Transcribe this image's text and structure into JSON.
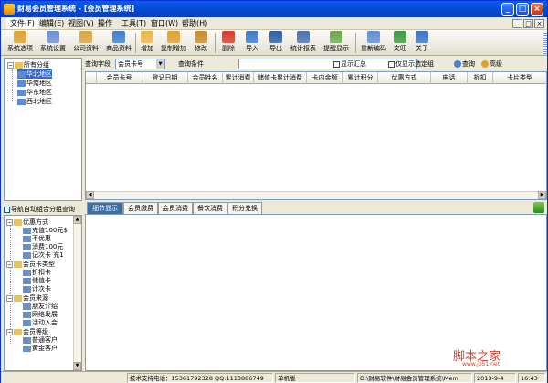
{
  "window": {
    "title": "财易会员管理系统 - [会员管理系统]"
  },
  "menu": [
    "文件(F)",
    "编辑(E)",
    "视图(V)",
    "操作",
    "工具(T)",
    "窗口(W)",
    "帮助(H)"
  ],
  "mdi_controls": [
    "_",
    "□",
    "×"
  ],
  "window_controls": [
    "_",
    "□",
    "×"
  ],
  "toolbar": [
    {
      "label": "系统选项",
      "icon": "settings-folder-icon",
      "color": "#e0a030"
    },
    {
      "label": "系统设置",
      "icon": "tools-icon",
      "color": "#6b8fd6"
    },
    {
      "label": "公司资料",
      "icon": "company-icon",
      "color": "#d9a441"
    },
    {
      "label": "商品资料",
      "icon": "goods-icon",
      "color": "#3f7fd0"
    },
    {
      "label": "增加",
      "icon": "add-icon",
      "color": "#e8b84a"
    },
    {
      "label": "复制增加",
      "icon": "copy-add-icon",
      "color": "#e0a030"
    },
    {
      "label": "修改",
      "icon": "edit-icon",
      "color": "#c98b2c"
    },
    {
      "label": "删除",
      "icon": "delete-icon",
      "color": "#d83a2a"
    },
    {
      "label": "导入",
      "icon": "import-icon",
      "color": "#3c78c9"
    },
    {
      "label": "导出",
      "icon": "export-icon",
      "color": "#2d5fa8"
    },
    {
      "label": "统计报表",
      "icon": "report-icon",
      "color": "#4a6fb5"
    },
    {
      "label": "提醒显示",
      "icon": "reminder-icon",
      "color": "#6aa84f"
    },
    {
      "label": "重新编码",
      "icon": "recode-icon",
      "color": "#5f8fd6"
    },
    {
      "label": "文旺",
      "icon": "person-icon",
      "color": "#3d9a3d"
    },
    {
      "label": "关于",
      "icon": "help-icon",
      "color": "#3a73c9"
    }
  ],
  "group_tree": {
    "root": "所有分组",
    "items": [
      "华北地区",
      "华南地区",
      "华东地区",
      "西北地区"
    ]
  },
  "auto_query_label": "导航自动组合分组查询",
  "nav_tree": [
    {
      "label": "优惠方式",
      "children": [
        "充值100元$",
        "不优惠",
        "消费100元",
        "记次卡 充1"
      ]
    },
    {
      "label": "会员卡类型",
      "children": [
        "折扣卡",
        "储值卡",
        "计次卡"
      ]
    },
    {
      "label": "会员来源",
      "children": [
        "朋友介绍",
        "网络发展",
        "活动入会"
      ]
    },
    {
      "label": "会员等级",
      "children": [
        "普通客户",
        "黄金客户"
      ]
    }
  ],
  "query": {
    "field_label": "查询字段",
    "field_value": "会员卡号",
    "condition_label": "查询条件",
    "condition_value": "",
    "show_summary": "显示汇总",
    "show_selected_only": "仅显示选定组",
    "search_btn": "查询",
    "advanced_btn": "高级"
  },
  "grid_columns": [
    "会员卡号",
    "登记日期",
    "会员姓名",
    "累计消费",
    "储值卡累计消费",
    "卡内余额",
    "累计积分",
    "优惠方式",
    "电话",
    "折扣",
    "卡片类型"
  ],
  "detail_tabs": [
    "细节显示",
    "会员缴费",
    "会员消费",
    "餐饮消费",
    "积分兑换"
  ],
  "status": {
    "support": "技术支持电话：15361792328 QQ:1113886749",
    "edition": "单机版",
    "path": "D:\\财易软件\\财易会员管理系统\\Mem",
    "date": "2013-9-4",
    "time": "16:43"
  },
  "watermark": {
    "text": "脚本之家",
    "url": "www.jb51.net"
  }
}
